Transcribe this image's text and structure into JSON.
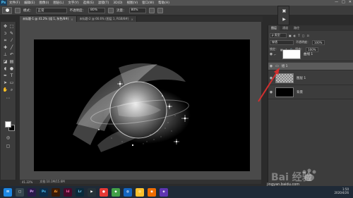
{
  "menubar": {
    "logo": "Ps",
    "items": [
      "文件(F)",
      "编辑(E)",
      "图像(I)",
      "图层(L)",
      "文字(Y)",
      "选择(S)",
      "滤镜(T)",
      "3D(D)",
      "视图(V)",
      "窗口(W)",
      "帮助(H)"
    ],
    "window_controls": [
      "—",
      "□",
      "✕"
    ]
  },
  "optbar": {
    "mode_label": "模式：",
    "mode_value": "正常",
    "opacity_label": "不透明度：",
    "opacity_value": "80%",
    "flow_label": "流量：",
    "flow_value": "80%"
  },
  "doc_tabs": [
    {
      "label": "未标题-1 @ 41.2% (组 1, 灰色/8#)",
      "close": "×",
      "active": true
    },
    {
      "label": "未标题-2 @ 66.6% (图层 1, RGB/8#)",
      "close": "×",
      "active": false
    }
  ],
  "status": {
    "zoom": "41.22%",
    "doc_size": "文档:10.1M/15.6M"
  },
  "layers_panel": {
    "tabs": [
      "图层",
      "通道",
      "路径"
    ],
    "kind_label": "ρ 类型",
    "blend_mode": "穿透",
    "opacity_label": "不透明度：",
    "opacity_value": "100%",
    "lock_label": "锁定：",
    "fill_label": "填充：",
    "fill_value": "100%",
    "layers": [
      {
        "name": "曲线 1"
      },
      {
        "name": "组 1"
      },
      {
        "name": "图层 1"
      },
      {
        "name": "背景"
      }
    ]
  },
  "taskbar": {
    "apps": [
      {
        "label": "Pr",
        "color": "#2a1a4a"
      },
      {
        "label": "Ps",
        "color": "#0b2d4a"
      },
      {
        "label": "Ai",
        "color": "#3a1a05"
      },
      {
        "label": "Id",
        "color": "#4a0a2a"
      },
      {
        "label": "Lr",
        "color": "#0a2a3a"
      }
    ],
    "time": "1:50",
    "date": "2020/4/26"
  },
  "watermark": {
    "text": "jingyan.baidu.com",
    "logo_text": "Bai 经验"
  },
  "colors": {
    "accent_red": "#d32f2f",
    "fg_swatch": "#ffffff",
    "bg_swatch": "#000000"
  }
}
